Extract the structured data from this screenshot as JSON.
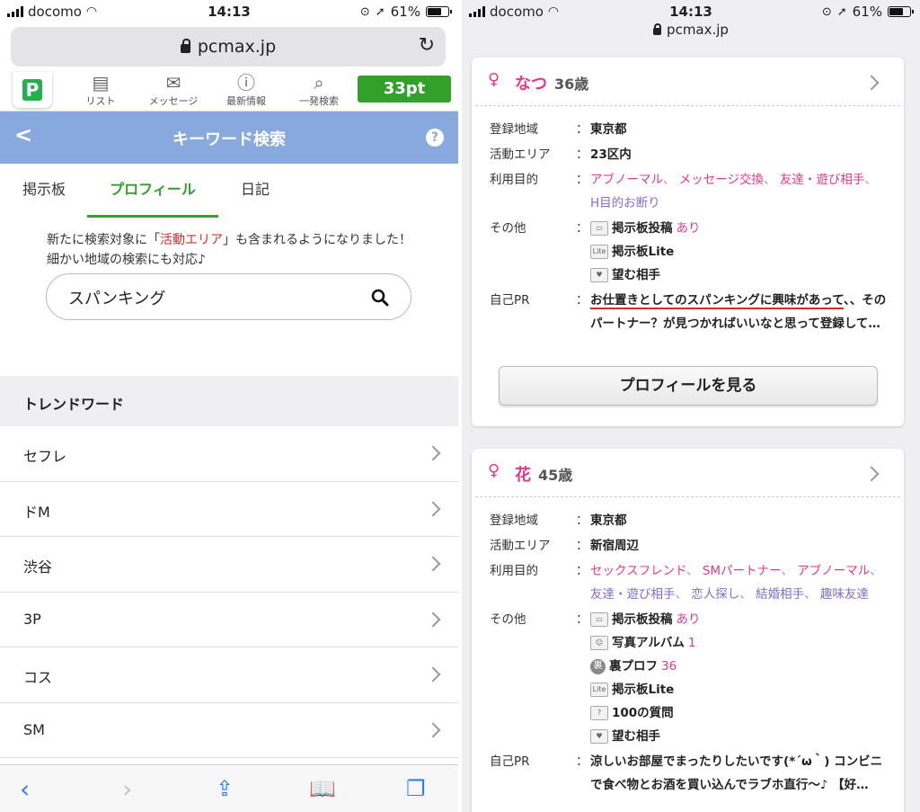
{
  "status_left": {
    "carrier": "docomo",
    "time": "14:13",
    "battery": "61%"
  },
  "status_right": {
    "carrier": "docomo",
    "time": "14:13",
    "battery": "61%"
  },
  "left": {
    "url": "pcmax.jp",
    "nav": {
      "logo": "P",
      "list": "リスト",
      "message": "メッセージ",
      "news": "最新情報",
      "search": "一発検索",
      "points": "33pt"
    },
    "header_title": "キーワード検索",
    "tabs": [
      "掲示板",
      "プロフィール",
      "日記"
    ],
    "notice_pre": "新たに検索対象に「",
    "notice_highlight": "活動エリア",
    "notice_post": "」も含まれるようになりました！",
    "notice_line2": "細かい地域の検索にも対応♪",
    "search_value": "スパンキング",
    "trend_title": "トレンドワード",
    "trends": [
      "セフレ",
      "ドM",
      "渋谷",
      "3P",
      "コス",
      "SM"
    ]
  },
  "right": {
    "url": "pcmax.jp",
    "labels": {
      "region": "登録地域",
      "area": "活動エリア",
      "purpose": "利用目的",
      "other": "その他",
      "pr": "自己PR",
      "colon": "："
    },
    "card1": {
      "symbol": "♀",
      "name": "なつ",
      "age": "36歳",
      "region": "東京都",
      "area": "23区内",
      "purposes": [
        "アブノーマル",
        "メッセージ交換",
        "友達・遊び相手",
        "H目的お断り"
      ],
      "other": {
        "board": "掲示板投稿",
        "board_suffix": "あり",
        "lite": "掲示板Lite",
        "wish": "望む相手"
      },
      "pr_underlined": "お仕置きとしてのスパンキングに興味があって",
      "pr_rest": "、、そのパートナー？が見つかればいいなと思って登録して…",
      "button": "プロフィールを見る"
    },
    "card2": {
      "symbol": "♀",
      "name": "花",
      "age": "45歳",
      "region": "東京都",
      "area": "新宿周辺",
      "purposes": [
        "セックスフレンド",
        "SMパートナー",
        "アブノーマル",
        "友達・遊び相手",
        "恋人探し",
        "結婚相手",
        "趣味友達"
      ],
      "other": {
        "board": "掲示板投稿",
        "board_suffix": "あり",
        "album": "写真アルバム",
        "album_count": "1",
        "ura": "裏プロフ",
        "ura_count": "36",
        "ura_icon": "裏",
        "lite": "掲示板Lite",
        "q100": "100の質問",
        "wish": "望む相手"
      },
      "pr": "涼しいお部屋でまったりしたいです(*´ω｀) コンビニで食べ物とお酒を買い込んでラブホ直行〜♪ 【好…"
    }
  }
}
